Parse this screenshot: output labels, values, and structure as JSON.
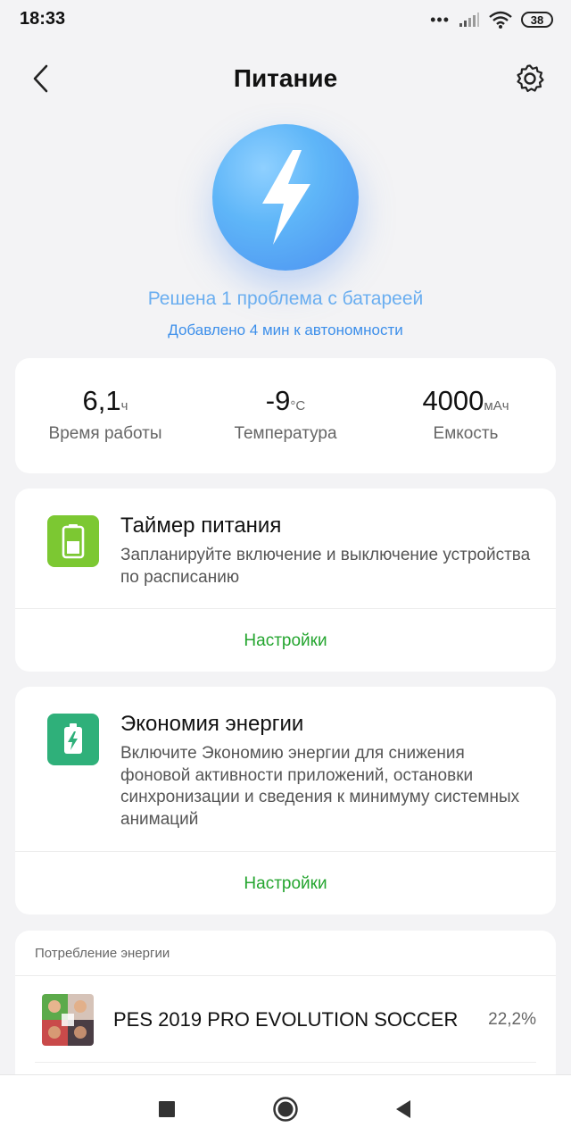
{
  "status_bar": {
    "time": "18:33",
    "dots": "•••",
    "battery_level": "38",
    "icons": [
      "signal-icon",
      "wifi-icon",
      "battery-icon"
    ]
  },
  "header": {
    "title": "Питание",
    "back_icon": "chevron-left-icon",
    "settings_icon": "gear-icon"
  },
  "hero": {
    "icon": "lightning-bolt-icon",
    "line1": "Решена 1 проблема с батареей",
    "line2": "Добавлено 4 мин к автономности"
  },
  "stats": [
    {
      "value": "6,1",
      "unit": "ч",
      "label": "Время работы"
    },
    {
      "value": "-9",
      "unit": "°C",
      "label": "Температура"
    },
    {
      "value": "4000",
      "unit": "мАч",
      "label": "Емкость"
    }
  ],
  "timer_card": {
    "icon": "power-timer-icon",
    "title": "Таймер питания",
    "description": "Запланируйте включение и выключение устройства по расписанию",
    "settings_label": "Настройки"
  },
  "saver_card": {
    "icon": "battery-saver-icon",
    "title": "Экономия энергии",
    "description": "Включите Экономию энергии для снижения фоновой активности приложений, остановки синхронизации и сведения к минимуму системных анимаций",
    "settings_label": "Настройки"
  },
  "usage": {
    "header": "Потребление энергии",
    "items": [
      {
        "name": "PES 2019 PRO EVOLUTION SOCCER",
        "percent": "22,2%"
      }
    ]
  },
  "nav": {
    "recent_icon": "square-icon",
    "home_icon": "circle-home-icon",
    "back_icon": "triangle-back-icon"
  },
  "colors": {
    "accent_green": "#24a52f",
    "hero_blue": "#5fb6f8",
    "link_blue": "#3d8fea",
    "timer_icon_bg": "#7cc832",
    "saver_icon_bg": "#2fb07a"
  }
}
